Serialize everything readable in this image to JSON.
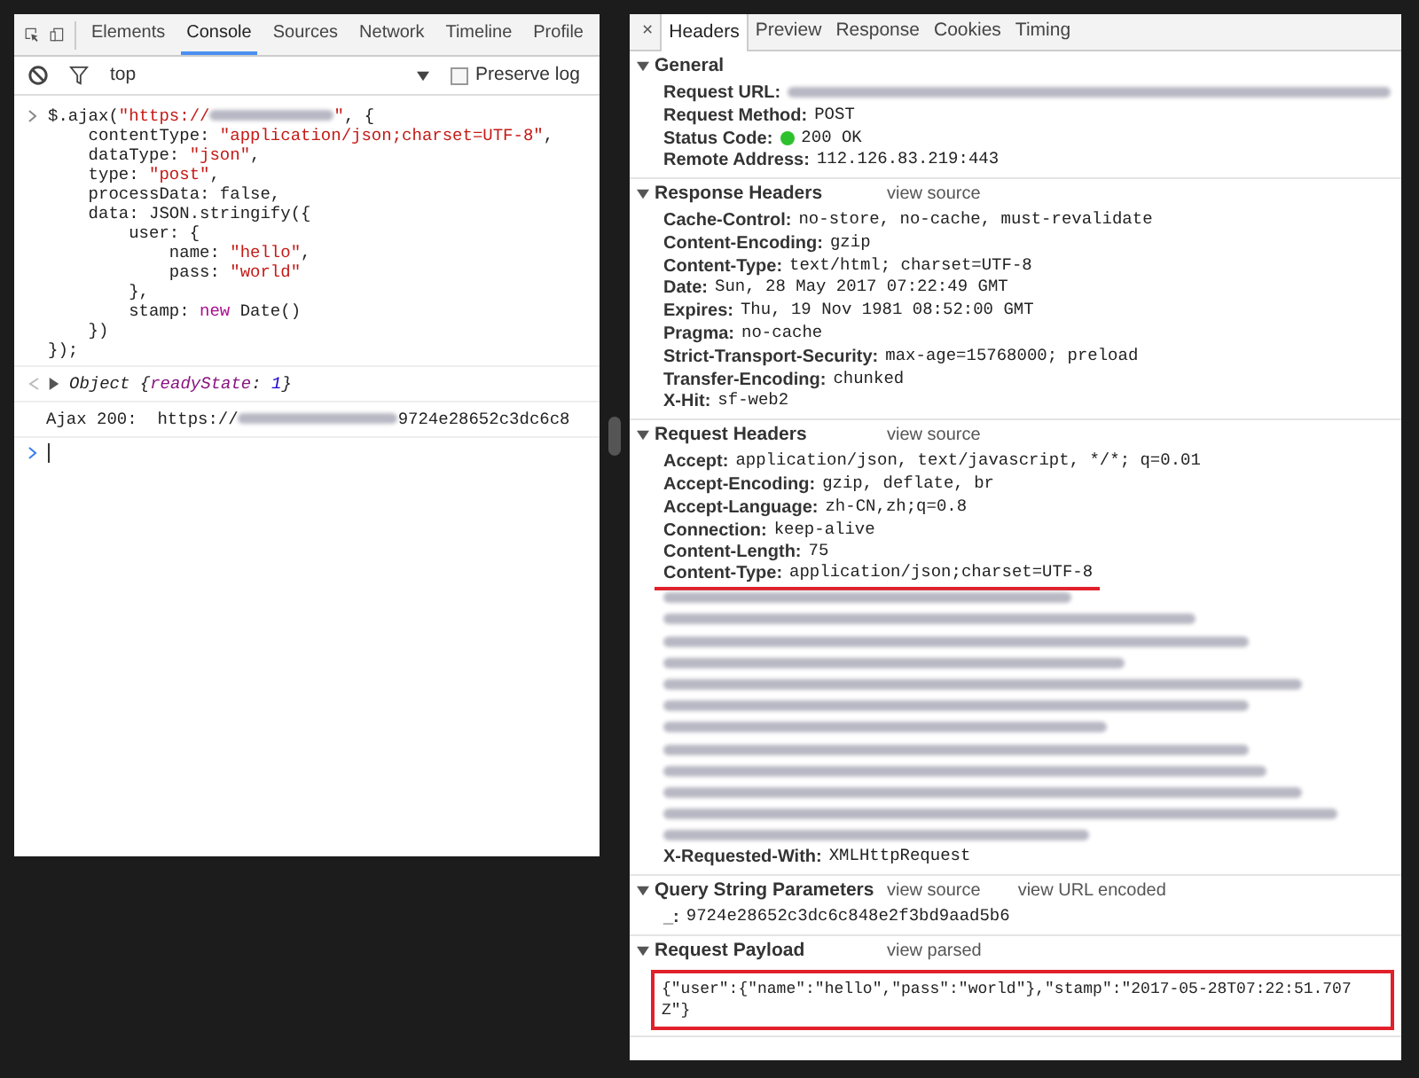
{
  "console": {
    "tabs": [
      {
        "label": "Elements",
        "selected": false
      },
      {
        "label": "Console",
        "selected": true
      },
      {
        "label": "Sources",
        "selected": false
      },
      {
        "label": "Network",
        "selected": false
      },
      {
        "label": "Timeline",
        "selected": false
      },
      {
        "label": "Profile",
        "selected": false
      }
    ],
    "context": "top",
    "preserve_log": {
      "label": "Preserve log",
      "checked": false
    },
    "entries": [
      {
        "kind": "input",
        "lines": [
          [
            {
              "kind": "plain",
              "text": "$.ajax("
            },
            {
              "kind": "string",
              "text": "\"https://"
            },
            {
              "kind": "redacted"
            },
            {
              "kind": "string",
              "text": "\""
            },
            {
              "kind": "plain",
              "text": ", {"
            }
          ],
          [
            {
              "kind": "plain",
              "text": "    contentType: "
            },
            {
              "kind": "string",
              "text": "\"application/json;charset=UTF-8\""
            },
            {
              "kind": "plain",
              "text": ","
            }
          ],
          [
            {
              "kind": "plain",
              "text": "    dataType: "
            },
            {
              "kind": "string",
              "text": "\"json\""
            },
            {
              "kind": "plain",
              "text": ","
            }
          ],
          [
            {
              "kind": "plain",
              "text": "    type: "
            },
            {
              "kind": "string",
              "text": "\"post\""
            },
            {
              "kind": "plain",
              "text": ","
            }
          ],
          [
            {
              "kind": "plain",
              "text": "    processData: false,"
            }
          ],
          [
            {
              "kind": "plain",
              "text": "    data: JSON.stringify({"
            }
          ],
          [
            {
              "kind": "plain",
              "text": "        user: {"
            }
          ],
          [
            {
              "kind": "plain",
              "text": "            name: "
            },
            {
              "kind": "string",
              "text": "\"hello\""
            },
            {
              "kind": "plain",
              "text": ","
            }
          ],
          [
            {
              "kind": "plain",
              "text": "            pass: "
            },
            {
              "kind": "string",
              "text": "\"world\""
            }
          ],
          [
            {
              "kind": "plain",
              "text": "        },"
            }
          ],
          [
            {
              "kind": "plain",
              "text": "        stamp: "
            },
            {
              "kind": "keyword",
              "text": "new"
            },
            {
              "kind": "plain",
              "text": " Date()"
            }
          ],
          [
            {
              "kind": "plain",
              "text": "    })"
            }
          ],
          [
            {
              "kind": "plain",
              "text": "});"
            }
          ]
        ]
      },
      {
        "kind": "result",
        "expanded": false,
        "tokens": [
          {
            "kind": "plain",
            "text": "Object {"
          },
          {
            "kind": "property",
            "text": "readyState"
          },
          {
            "kind": "plain",
            "text": ": "
          },
          {
            "kind": "number",
            "text": "1"
          },
          {
            "kind": "plain",
            "text": "}"
          }
        ]
      },
      {
        "kind": "log",
        "tokens": [
          {
            "kind": "plain",
            "text": "Ajax 200:  https://"
          },
          {
            "kind": "redacted"
          },
          {
            "kind": "plain",
            "text": "9724e28652c3dc6c8"
          }
        ]
      },
      {
        "kind": "prompt"
      }
    ]
  },
  "details": {
    "close": "×",
    "tabs": [
      {
        "label": "Headers",
        "selected": true
      },
      {
        "label": "Preview",
        "selected": false
      },
      {
        "label": "Response",
        "selected": false
      },
      {
        "label": "Cookies",
        "selected": false
      },
      {
        "label": "Timing",
        "selected": false
      }
    ],
    "sections": [
      {
        "title": "General",
        "expanded": true,
        "rows": [
          {
            "kind": "redacted_value",
            "name": "Request URL:"
          },
          {
            "kind": "header",
            "name": "Request Method:",
            "value": "POST"
          },
          {
            "kind": "status",
            "name": "Status Code:",
            "color": "#2ec12e",
            "value": "200 OK"
          },
          {
            "kind": "header",
            "name": "Remote Address:",
            "value": "112.126.83.219:443"
          }
        ]
      },
      {
        "title": "Response Headers",
        "expanded": true,
        "links": [
          "view source"
        ],
        "rows": [
          {
            "kind": "header",
            "name": "Cache-Control:",
            "value": "no-store, no-cache, must-revalidate"
          },
          {
            "kind": "header",
            "name": "Content-Encoding:",
            "value": "gzip"
          },
          {
            "kind": "header",
            "name": "Content-Type:",
            "value": "text/html; charset=UTF-8"
          },
          {
            "kind": "header",
            "name": "Date:",
            "value": "Sun, 28 May 2017 07:22:49 GMT"
          },
          {
            "kind": "header",
            "name": "Expires:",
            "value": "Thu, 19 Nov 1981 08:52:00 GMT"
          },
          {
            "kind": "header",
            "name": "Pragma:",
            "value": "no-cache"
          },
          {
            "kind": "header",
            "name": "Strict-Transport-Security:",
            "value": "max-age=15768000; preload"
          },
          {
            "kind": "header",
            "name": "Transfer-Encoding:",
            "value": "chunked"
          },
          {
            "kind": "header",
            "name": "X-Hit:",
            "value": "sf-web2"
          }
        ]
      },
      {
        "title": "Request Headers",
        "expanded": true,
        "links": [
          "view source"
        ],
        "rows": [
          {
            "kind": "header",
            "name": "Accept:",
            "value": "application/json, text/javascript, */*; q=0.01"
          },
          {
            "kind": "header",
            "name": "Accept-Encoding:",
            "value": "gzip, deflate, br"
          },
          {
            "kind": "header",
            "name": "Accept-Language:",
            "value": "zh-CN,zh;q=0.8"
          },
          {
            "kind": "header",
            "name": "Connection:",
            "value": "keep-alive"
          },
          {
            "kind": "header",
            "name": "Content-Length:",
            "value": "75"
          },
          {
            "kind": "header",
            "name": "Content-Type:",
            "value": "application/json;charset=UTF-8",
            "underlined": true
          },
          {
            "kind": "redacted"
          },
          {
            "kind": "redacted"
          },
          {
            "kind": "redacted"
          },
          {
            "kind": "redacted"
          },
          {
            "kind": "redacted"
          },
          {
            "kind": "redacted"
          },
          {
            "kind": "redacted"
          },
          {
            "kind": "redacted"
          },
          {
            "kind": "redacted"
          },
          {
            "kind": "redacted"
          },
          {
            "kind": "redacted"
          },
          {
            "kind": "redacted"
          },
          {
            "kind": "header",
            "name": "X-Requested-With:",
            "value": "XMLHttpRequest"
          }
        ]
      },
      {
        "title": "Query String Parameters",
        "expanded": true,
        "links": [
          "view source",
          "view URL encoded"
        ],
        "rows": [
          {
            "kind": "header",
            "name": "_:",
            "value": "9724e28652c3dc6c848e2f3bd9aad5b6"
          }
        ]
      },
      {
        "title": "Request Payload",
        "expanded": true,
        "links": [
          "view parsed"
        ],
        "rows": [
          {
            "kind": "payload",
            "boxed": true,
            "lines": [
              "{\"user\":{\"name\":\"hello\",\"pass\":\"world\"},\"stamp\":\"2017-05-28T07:22:51.707",
              "Z\"}"
            ]
          }
        ]
      }
    ]
  }
}
